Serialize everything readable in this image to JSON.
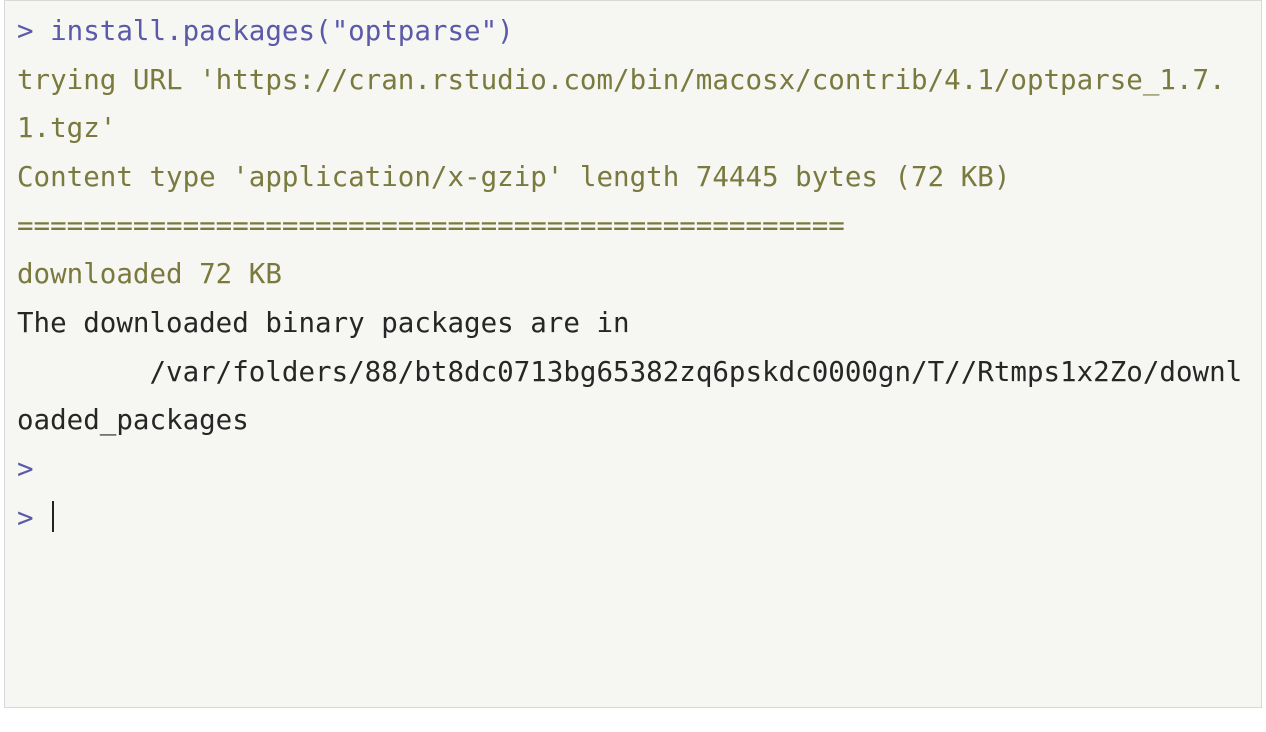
{
  "console": {
    "prompt": ">",
    "command": "install.packages(\"optparse\")",
    "msg_trying": "trying URL 'https://cran.rstudio.com/bin/macosx/contrib/4.1/optparse_1.7.1.tgz'",
    "msg_content_type": "Content type 'application/x-gzip' length 74445 bytes (72 KB)",
    "msg_progress": "==================================================",
    "msg_downloaded": "downloaded 72 KB",
    "msg_blank": "",
    "txt_pkgloc_1": "The downloaded binary packages are in",
    "txt_pkgloc_2": "        /var/folders/88/bt8dc0713bg65382zq6pskdc0000gn/T//Rtmps1x2Zo/downloaded_packages"
  }
}
